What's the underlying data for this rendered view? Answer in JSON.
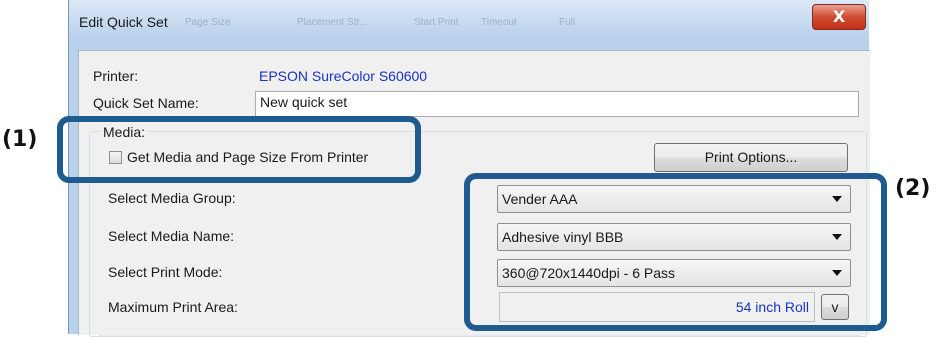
{
  "window": {
    "title": "Edit Quick Set",
    "ghost_tabs": [
      "Page Size",
      "Placement Str...",
      "Start Print",
      "Timeout",
      "Full"
    ],
    "close_glyph": "X"
  },
  "form": {
    "printer_label": "Printer:",
    "printer_value": "EPSON SureColor S60600",
    "quickset_label": "Quick Set Name:",
    "quickset_value": "New quick set",
    "media_group_title": "Media:",
    "get_media_label": "Get Media and Page Size From Printer",
    "get_media_checked": false,
    "print_options_button": "Print Options...",
    "media_group_label": "Select Media Group:",
    "media_group_value": "Vender AAA",
    "media_name_label": "Select Media Name:",
    "media_name_value": "Adhesive vinyl BBB",
    "print_mode_label": "Select Print Mode:",
    "print_mode_value": "360@720x1440dpi - 6 Pass",
    "max_area_label": "Maximum Print Area:",
    "max_area_value": "54 inch Roll",
    "max_area_button": "v"
  },
  "callouts": {
    "one": "(1)",
    "two": "(2)"
  },
  "colors": {
    "callout_border": "#1f5b8e",
    "link_blue": "#1a33c9",
    "close_red": "#c43218"
  }
}
